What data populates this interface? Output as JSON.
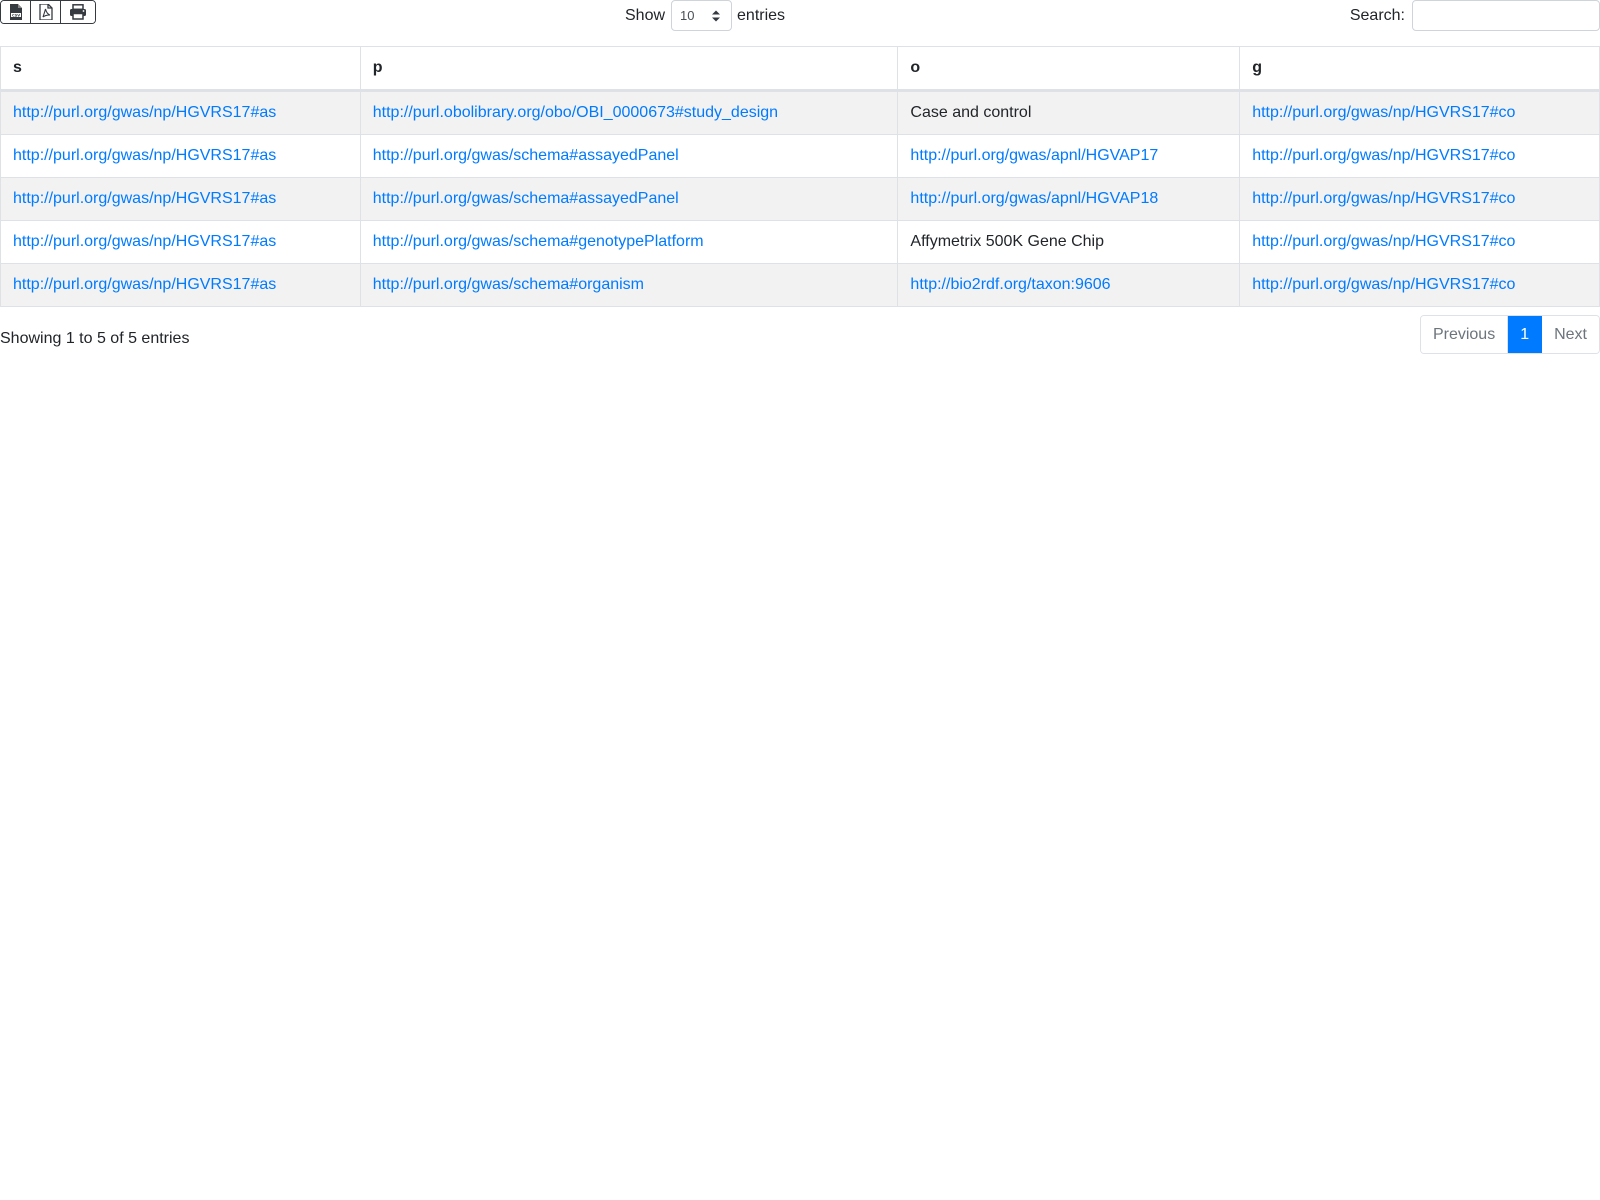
{
  "toolbar": {
    "buttons": [
      {
        "name": "csv-icon"
      },
      {
        "name": "pdf-icon"
      },
      {
        "name": "print-icon"
      }
    ]
  },
  "length": {
    "show_label": "Show",
    "value": "10",
    "entries_label": "entries"
  },
  "search": {
    "label": "Search:",
    "value": ""
  },
  "table": {
    "headers": [
      "s",
      "p",
      "o",
      "g"
    ],
    "rows": [
      [
        {
          "text": "http://purl.org/gwas/np/HGVRS17#as",
          "link": true
        },
        {
          "text": "http://purl.obolibrary.org/obo/OBI_0000673#study_design",
          "link": true
        },
        {
          "text": "Case and control",
          "link": false
        },
        {
          "text": "http://purl.org/gwas/np/HGVRS17#co",
          "link": true
        }
      ],
      [
        {
          "text": "http://purl.org/gwas/np/HGVRS17#as",
          "link": true
        },
        {
          "text": "http://purl.org/gwas/schema#assayedPanel",
          "link": true
        },
        {
          "text": "http://purl.org/gwas/apnl/HGVAP17",
          "link": true
        },
        {
          "text": "http://purl.org/gwas/np/HGVRS17#co",
          "link": true
        }
      ],
      [
        {
          "text": "http://purl.org/gwas/np/HGVRS17#as",
          "link": true
        },
        {
          "text": "http://purl.org/gwas/schema#assayedPanel",
          "link": true
        },
        {
          "text": "http://purl.org/gwas/apnl/HGVAP18",
          "link": true
        },
        {
          "text": "http://purl.org/gwas/np/HGVRS17#co",
          "link": true
        }
      ],
      [
        {
          "text": "http://purl.org/gwas/np/HGVRS17#as",
          "link": true
        },
        {
          "text": "http://purl.org/gwas/schema#genotypePlatform",
          "link": true
        },
        {
          "text": "Affymetrix 500K Gene Chip",
          "link": false
        },
        {
          "text": "http://purl.org/gwas/np/HGVRS17#co",
          "link": true
        }
      ],
      [
        {
          "text": "http://purl.org/gwas/np/HGVRS17#as",
          "link": true
        },
        {
          "text": "http://purl.org/gwas/schema#organism",
          "link": true
        },
        {
          "text": "http://bio2rdf.org/taxon:9606",
          "link": true
        },
        {
          "text": "http://purl.org/gwas/np/HGVRS17#co",
          "link": true
        }
      ]
    ]
  },
  "footer": {
    "info": "Showing 1 to 5 of 5 entries",
    "previous": "Previous",
    "current_page": "1",
    "next": "Next"
  },
  "colors": {
    "link": "#007bff",
    "active_page": "#007bff",
    "stripe": "#f2f2f2"
  }
}
